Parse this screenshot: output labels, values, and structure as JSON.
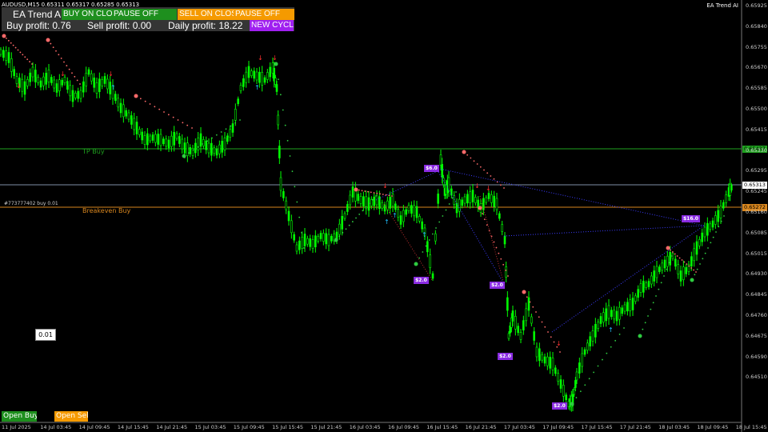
{
  "chart_info": "AUDUSD,M15  0.65311 0.65317 0.65285 0.65313",
  "ea_name": "EA Trend AI",
  "panel": {
    "title": "EA Trend A",
    "buy_on_close": "BUY ON CLOSE BUY",
    "buy_pause": "PAUSE OFF",
    "sell_on_close": "SELL ON CLOSE SELL",
    "sell_pause": "PAUSE OFF",
    "buy_profit": "Buy profit: 0.76",
    "sell_profit": "Sell profit: 0.00",
    "daily_profit": "Daily profit: 18.22",
    "new_cycle": "NEW CYCLE"
  },
  "lot_value": "0.01",
  "open_buy": "Open Buy",
  "open_sell": "Open Sell",
  "lines": {
    "tp_label": "TP Buy",
    "breakeven_label": "Breakeven Buy",
    "order_label": "#773777402 buy 0.01",
    "tp_price": "0.65437",
    "current_price": "0.65313",
    "breakeven_price": "0.65272"
  },
  "price_ticks": [
    "0.65925",
    "0.65840",
    "0.65755",
    "0.65670",
    "0.65585",
    "0.65500",
    "0.65415",
    "0.65330",
    "0.65295",
    "0.65245",
    "0.65160",
    "0.65085",
    "0.65015",
    "0.64930",
    "0.64845",
    "0.64760",
    "0.64675",
    "0.64590",
    "0.64510"
  ],
  "time_ticks": [
    "11 Jul 2025",
    "14 Jul 03:45",
    "14 Jul 09:45",
    "14 Jul 15:45",
    "14 Jul 21:45",
    "15 Jul 03:45",
    "15 Jul 09:45",
    "15 Jul 15:45",
    "15 Jul 21:45",
    "16 Jul 03:45",
    "16 Jul 09:45",
    "16 Jul 15:45",
    "16 Jul 21:45",
    "17 Jul 03:45",
    "17 Jul 09:45",
    "17 Jul 15:45",
    "17 Jul 21:45",
    "18 Jul 03:45",
    "18 Jul 09:45",
    "18 Jul 15:45"
  ],
  "profit_tags": [
    "$6.0",
    "$2.0",
    "$2.0",
    "$2.0",
    "$2.0",
    "$16.0"
  ],
  "colors": {
    "bg": "#000000",
    "candle": "#00ff00",
    "tp_line": "#1fa21f",
    "be_line": "#d8861e",
    "price_line": "#7f8fa6",
    "buy_green": "#1e8f1e",
    "sell_orange": "#f59a00",
    "purple": "#a020f0"
  }
}
